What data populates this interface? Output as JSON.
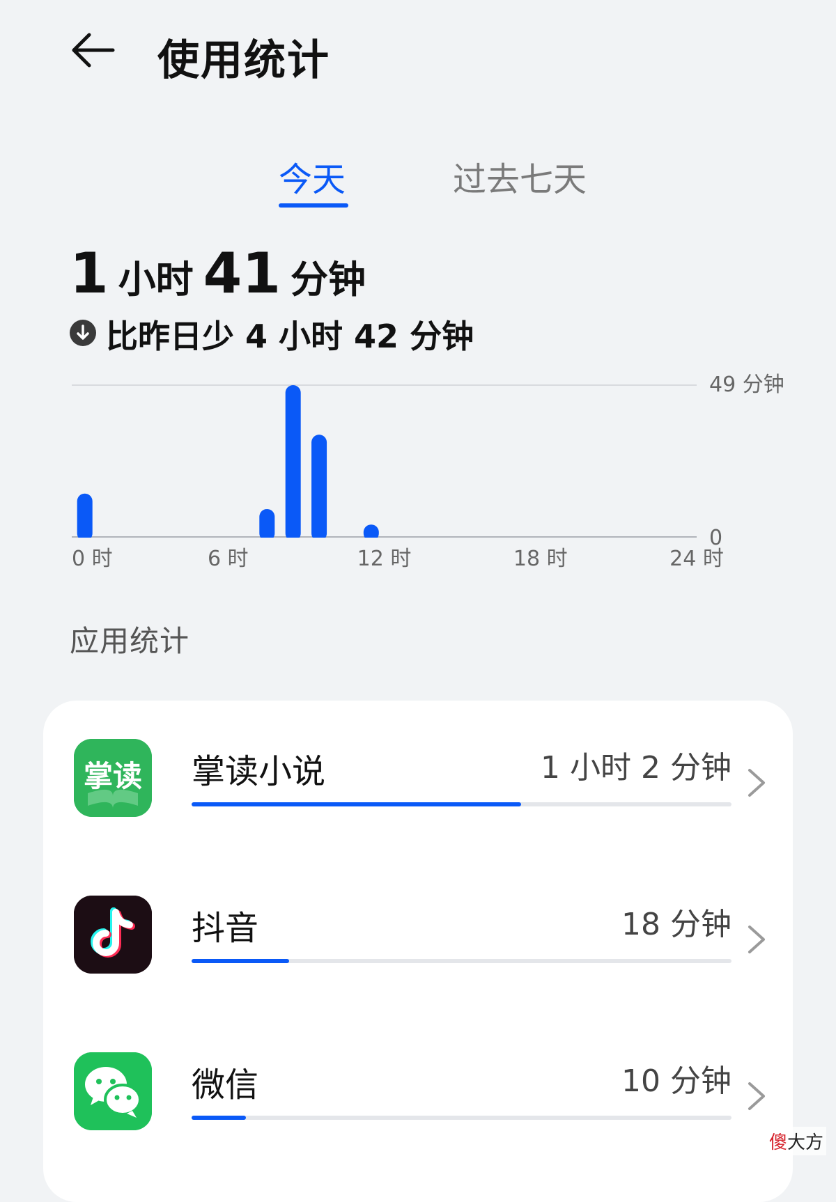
{
  "header": {
    "title": "使用统计",
    "back_icon": "arrow-left-icon"
  },
  "tabs": [
    {
      "label": "今天",
      "active": true
    },
    {
      "label": "过去七天",
      "active": false
    }
  ],
  "colors": {
    "accent": "#0a59f7",
    "background": "#f1f3f5",
    "card": "#ffffff"
  },
  "summary": {
    "total_hours": "1",
    "hours_unit": "小时",
    "total_minutes": "41",
    "minutes_unit": "分钟",
    "compare_icon": "arrow-down-circle-icon",
    "compare_text": "比昨日少 4 小时 42 分钟"
  },
  "chart_data": {
    "type": "bar",
    "x_tick_labels": [
      "0 时",
      "6 时",
      "12 时",
      "18 时",
      "24 时"
    ],
    "y_max_label": "49 分钟",
    "y_min_label": "0",
    "ylim": [
      0,
      49
    ],
    "x_range": [
      0,
      24
    ],
    "bars": [
      {
        "hour": 0,
        "value": 14
      },
      {
        "hour": 7,
        "value": 9
      },
      {
        "hour": 8,
        "value": 49
      },
      {
        "hour": 9,
        "value": 33
      },
      {
        "hour": 11,
        "value": 4
      }
    ],
    "color": "#0a59f7"
  },
  "section": {
    "title": "应用统计"
  },
  "apps": [
    {
      "name": "掌读小说",
      "time": "1 小时 2 分钟",
      "minutes": 62,
      "share": 0.61,
      "icon": "zhangdu-app-icon",
      "icon_text": "掌读",
      "icon_color": "#2fb55b"
    },
    {
      "name": "抖音",
      "time": "18 分钟",
      "minutes": 18,
      "share": 0.18,
      "icon": "douyin-app-icon",
      "icon_color": "#1c0d14"
    },
    {
      "name": "微信",
      "time": "10 分钟",
      "minutes": 10,
      "share": 0.1,
      "icon": "wechat-app-icon",
      "icon_color": "#1fc15a"
    }
  ],
  "watermark": {
    "part_a": "傻",
    "part_b": "大方"
  }
}
